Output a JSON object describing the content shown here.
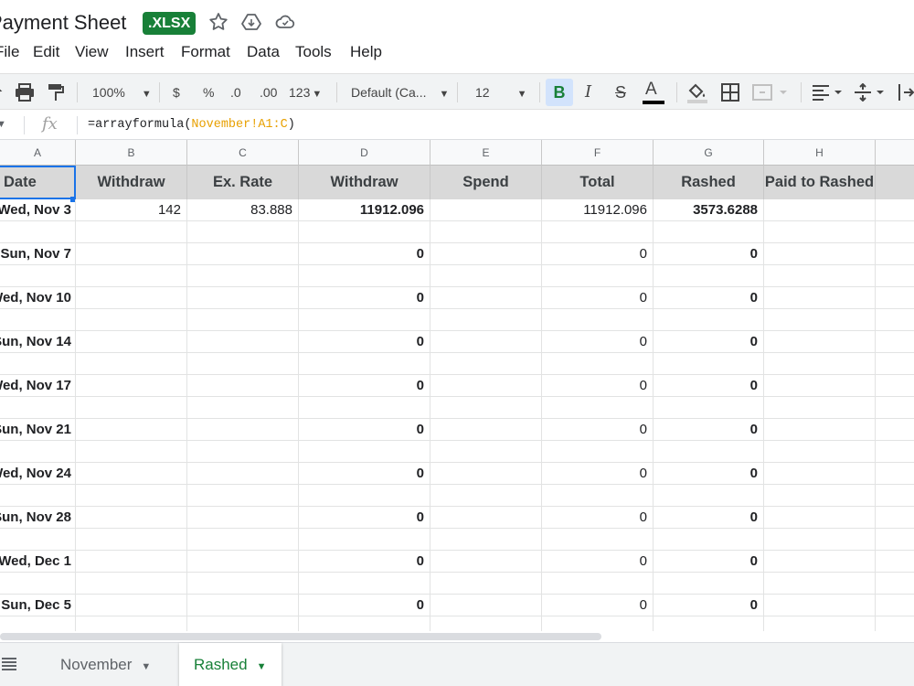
{
  "header": {
    "title": "Payment Sheet",
    "badge": ".XLSX"
  },
  "menu": [
    "File",
    "Edit",
    "View",
    "Insert",
    "Format",
    "Data",
    "Tools",
    "Help"
  ],
  "toolbar": {
    "zoom": "100%",
    "currency": "$",
    "percent": "%",
    "dec_decrease": ".0",
    "dec_increase": ".00",
    "number_format": "123",
    "font": "Default (Ca...",
    "font_size": "12",
    "bold": "B",
    "italic": "I",
    "strike": "S",
    "text_color": "A"
  },
  "formula_bar": {
    "fx": "fx",
    "formula_prefix": "=arrayformula(",
    "formula_ref": "November!A1:C",
    "formula_suffix": ")"
  },
  "columns": [
    "A",
    "B",
    "C",
    "D",
    "E",
    "F",
    "G",
    "H"
  ],
  "header_row": [
    "Date",
    "Withdraw",
    "Ex. Rate",
    "Withdraw",
    "Spend",
    "Total",
    "Rashed",
    "Paid to Rashed"
  ],
  "rows": [
    {
      "date": "Wed, Nov 3",
      "b": "142",
      "c": "83.888",
      "d": "11912.096",
      "e": "",
      "f": "11912.096",
      "g": "3573.6288",
      "h": ""
    },
    {
      "date": "",
      "b": "",
      "c": "",
      "d": "",
      "e": "",
      "f": "",
      "g": "",
      "h": ""
    },
    {
      "date": "Sun, Nov 7",
      "b": "",
      "c": "",
      "d": "0",
      "e": "",
      "f": "0",
      "g": "0",
      "h": ""
    },
    {
      "date": "",
      "b": "",
      "c": "",
      "d": "",
      "e": "",
      "f": "",
      "g": "",
      "h": ""
    },
    {
      "date": "Wed, Nov 10",
      "b": "",
      "c": "",
      "d": "0",
      "e": "",
      "f": "0",
      "g": "0",
      "h": ""
    },
    {
      "date": "",
      "b": "",
      "c": "",
      "d": "",
      "e": "",
      "f": "",
      "g": "",
      "h": ""
    },
    {
      "date": "Sun, Nov 14",
      "b": "",
      "c": "",
      "d": "0",
      "e": "",
      "f": "0",
      "g": "0",
      "h": ""
    },
    {
      "date": "",
      "b": "",
      "c": "",
      "d": "",
      "e": "",
      "f": "",
      "g": "",
      "h": ""
    },
    {
      "date": "Wed, Nov 17",
      "b": "",
      "c": "",
      "d": "0",
      "e": "",
      "f": "0",
      "g": "0",
      "h": ""
    },
    {
      "date": "",
      "b": "",
      "c": "",
      "d": "",
      "e": "",
      "f": "",
      "g": "",
      "h": ""
    },
    {
      "date": "Sun, Nov 21",
      "b": "",
      "c": "",
      "d": "0",
      "e": "",
      "f": "0",
      "g": "0",
      "h": ""
    },
    {
      "date": "",
      "b": "",
      "c": "",
      "d": "",
      "e": "",
      "f": "",
      "g": "",
      "h": ""
    },
    {
      "date": "Wed, Nov 24",
      "b": "",
      "c": "",
      "d": "0",
      "e": "",
      "f": "0",
      "g": "0",
      "h": ""
    },
    {
      "date": "",
      "b": "",
      "c": "",
      "d": "",
      "e": "",
      "f": "",
      "g": "",
      "h": ""
    },
    {
      "date": "Sun, Nov 28",
      "b": "",
      "c": "",
      "d": "0",
      "e": "",
      "f": "0",
      "g": "0",
      "h": ""
    },
    {
      "date": "",
      "b": "",
      "c": "",
      "d": "",
      "e": "",
      "f": "",
      "g": "",
      "h": ""
    },
    {
      "date": "Wed, Dec 1",
      "b": "",
      "c": "",
      "d": "0",
      "e": "",
      "f": "0",
      "g": "0",
      "h": ""
    },
    {
      "date": "",
      "b": "",
      "c": "",
      "d": "",
      "e": "",
      "f": "",
      "g": "",
      "h": ""
    },
    {
      "date": "Sun, Dec 5",
      "b": "",
      "c": "",
      "d": "0",
      "e": "",
      "f": "0",
      "g": "0",
      "h": ""
    },
    {
      "date": "",
      "b": "",
      "c": "",
      "d": "",
      "e": "",
      "f": "",
      "g": "",
      "h": ""
    }
  ],
  "sheets": [
    {
      "label": "November",
      "active": false
    },
    {
      "label": "Rashed",
      "active": true
    }
  ],
  "colors": {
    "accent_green": "#188038",
    "selection_blue": "#1a73e8",
    "header_fill": "#d9d9d9",
    "formula_ref": "#e8a000"
  },
  "icons": [
    "star-icon",
    "move-to-drive-icon",
    "cloud-status-icon",
    "print-icon",
    "paint-format-icon",
    "fill-color-icon",
    "borders-icon",
    "merge-cells-icon",
    "align-icon",
    "valign-icon",
    "all-sheets-icon"
  ]
}
